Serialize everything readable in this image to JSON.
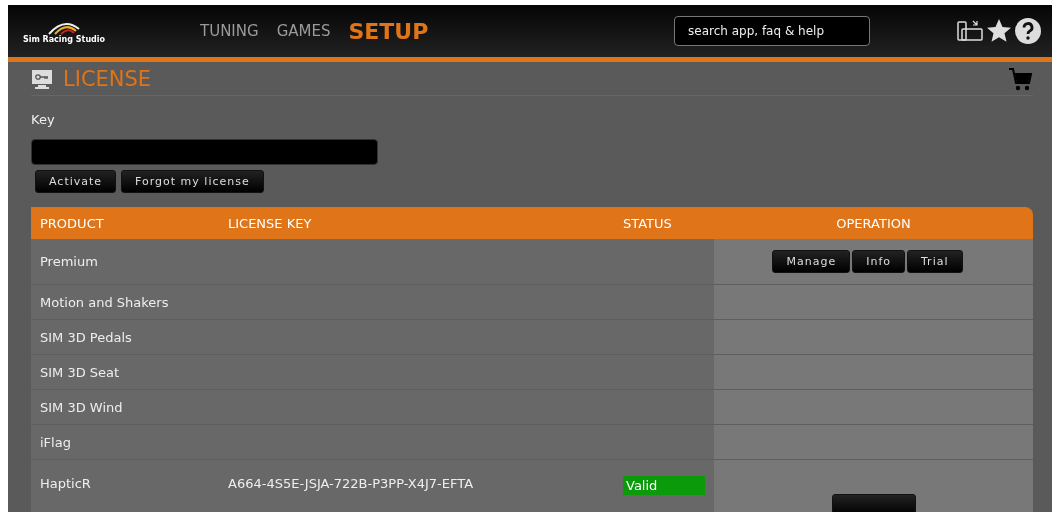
{
  "header": {
    "logo_text": "Sim Racing Studio",
    "nav": [
      {
        "label": "TUNING",
        "selected": false
      },
      {
        "label": "GAMES",
        "selected": false
      },
      {
        "label": "SETUP",
        "selected": true
      }
    ],
    "search": {
      "placeholder": "search app, faq & help"
    }
  },
  "section": {
    "title": "LICENSE"
  },
  "key_form": {
    "label": "Key",
    "buttons": [
      "Activate",
      "Forgot my license"
    ]
  },
  "table": {
    "columns": [
      "PRODUCT",
      "LICENSE KEY",
      "STATUS",
      "OPERATION"
    ],
    "rows": [
      {
        "product": "Premium",
        "operations": [
          "Manage",
          "Info",
          "Trial"
        ]
      },
      {
        "product": "Motion and Shakers"
      },
      {
        "product": "SIM 3D Pedals"
      },
      {
        "product": "SIM 3D Seat"
      },
      {
        "product": "SIM 3D Wind"
      },
      {
        "product": "iFlag"
      },
      {
        "product": "HapticR",
        "license_key": "A664-4S5E-JSJA-722B-P3PP-X4J7-EFTA",
        "status": "Valid",
        "has_operation_button": true
      }
    ]
  }
}
